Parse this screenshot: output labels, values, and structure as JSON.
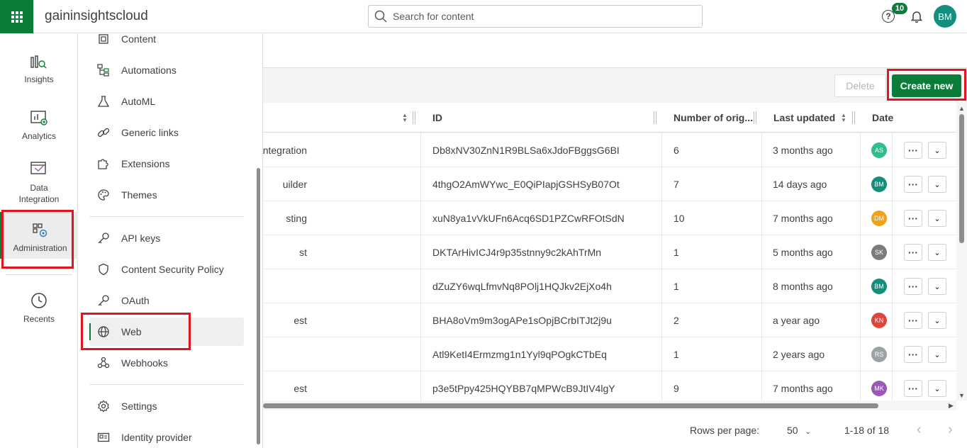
{
  "header": {
    "tenant": "gaininsightscloud",
    "search_placeholder": "Search for content",
    "help_badge": "10",
    "user_initials": "BM"
  },
  "rail": {
    "items": [
      {
        "label": "Insights",
        "icon": "insights-icon"
      },
      {
        "label": "Analytics",
        "icon": "analytics-icon"
      },
      {
        "label": "Data Integration",
        "icon": "data-integration-icon"
      },
      {
        "label": "Administration",
        "icon": "administration-icon"
      },
      {
        "label": "Recents",
        "icon": "recents-clock-icon"
      }
    ]
  },
  "subnav": {
    "items": [
      {
        "label": "Content",
        "icon": "content-icon"
      },
      {
        "label": "Automations",
        "icon": "automations-icon"
      },
      {
        "label": "AutoML",
        "icon": "flask-icon"
      },
      {
        "label": "Generic links",
        "icon": "link-icon"
      },
      {
        "label": "Extensions",
        "icon": "puzzle-icon"
      },
      {
        "label": "Themes",
        "icon": "palette-icon"
      },
      {
        "label": "API keys",
        "icon": "key-icon"
      },
      {
        "label": "Content Security Policy",
        "icon": "shield-icon"
      },
      {
        "label": "OAuth",
        "icon": "key-icon"
      },
      {
        "label": "Web",
        "icon": "globe-icon"
      },
      {
        "label": "Webhooks",
        "icon": "webhooks-icon"
      },
      {
        "label": "Settings",
        "icon": "gear-icon"
      },
      {
        "label": "Identity provider",
        "icon": "id-card-icon"
      }
    ]
  },
  "toolbar": {
    "delete_label": "Delete",
    "create_label": "Create new"
  },
  "table": {
    "columns": [
      "",
      "ID",
      "Number of orig...",
      "Last updated",
      "Date"
    ],
    "rows": [
      {
        "name": "ntegration",
        "id": "Db8xNV30ZnN1R9BLSa6xJdoFBggsG6BI",
        "origins": "6",
        "updated": "3 months ago",
        "owner": "AS",
        "owner_color": "#2fbf8f"
      },
      {
        "name": "uilder",
        "id": "4thgO2AmWYwc_E0QiPIapjGSHSyB07Ot",
        "origins": "7",
        "updated": "14 days ago",
        "owner": "BM",
        "owner_color": "#138f7d"
      },
      {
        "name": "sting",
        "id": "xuN8ya1vVkUFn6Acq6SD1PZCwRFOtSdN",
        "origins": "10",
        "updated": "7 months ago",
        "owner": "DM",
        "owner_color": "#f0a21a"
      },
      {
        "name": "st",
        "id": "DKTArHivICJ4r9p35stnny9c2kAhTrMn",
        "origins": "1",
        "updated": "5 months ago",
        "owner": "SK",
        "owner_color": "#7b7b7b"
      },
      {
        "name": "",
        "id": "dZuZY6wqLfmvNq8POlj1HQJkv2EjXo4h",
        "origins": "1",
        "updated": "8 months ago",
        "owner": "BM",
        "owner_color": "#138f7d"
      },
      {
        "name": "est",
        "id": "BHA8oVm9m3ogAPe1sOpjBCrbITJt2j9u",
        "origins": "2",
        "updated": "a year ago",
        "owner": "KN",
        "owner_color": "#e0453a"
      },
      {
        "name": "",
        "id": "Atl9KetI4Ermzmg1n1Yyl9qPOgkCTbEq",
        "origins": "1",
        "updated": "2 years ago",
        "owner": "RS",
        "owner_color": "#9aa3a3"
      },
      {
        "name": "est",
        "id": "p3e5tPpy425HQYBB7qMPWcB9JtIV4lgY",
        "origins": "9",
        "updated": "7 months ago",
        "owner": "MK",
        "owner_color": "#9b59b6"
      }
    ]
  },
  "pager": {
    "rows_label": "Rows per page:",
    "rows_value": "50",
    "range": "1-18 of 18"
  }
}
